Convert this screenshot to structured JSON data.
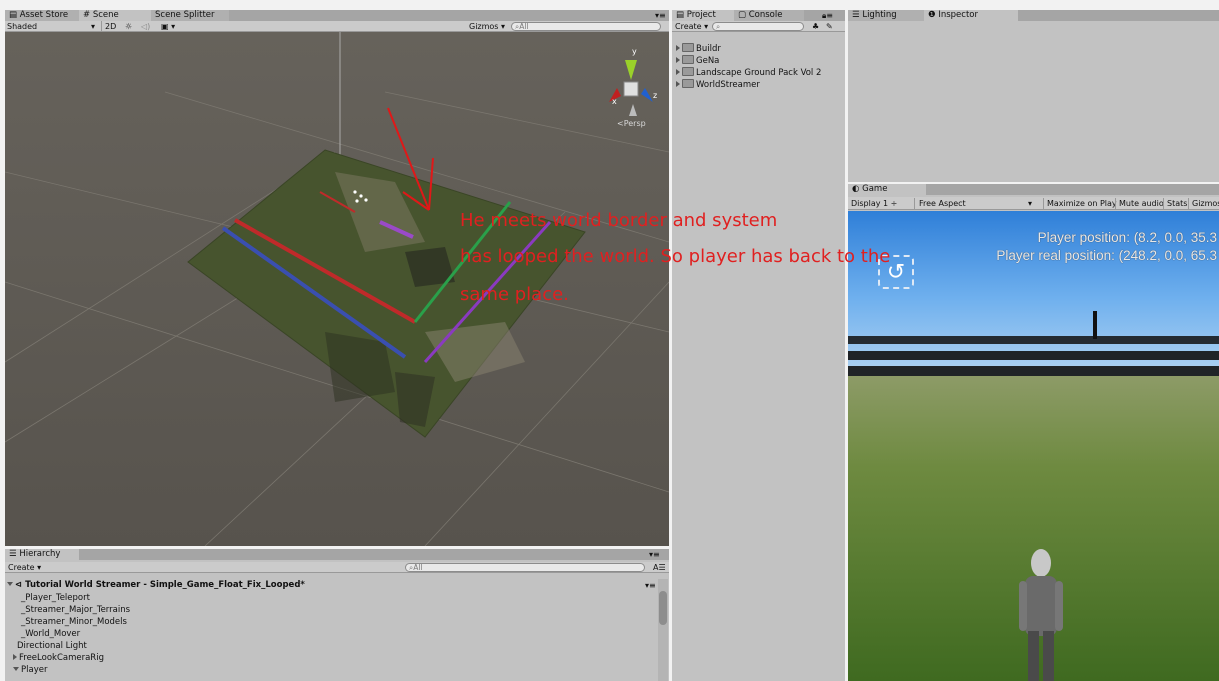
{
  "scene_panel": {
    "tabs": [
      "Asset Store",
      "Scene",
      "Scene Splitter"
    ],
    "draw_mode": "Shaded",
    "mode_2d": "2D",
    "gizmos_label": "Gizmos",
    "search_placeholder": "All",
    "persp_label": "Persp",
    "axis_labels": {
      "x": "x",
      "y": "y",
      "z": "z"
    }
  },
  "project_panel": {
    "tabs": [
      "Project",
      "Console"
    ],
    "create_label": "Create",
    "folders": [
      "Buildr",
      "GeNa",
      "Landscape Ground Pack Vol 2",
      "WorldStreamer"
    ]
  },
  "inspector_panel": {
    "tabs": [
      "Lighting",
      "Inspector"
    ]
  },
  "game_panel": {
    "tab": "Game",
    "display": "Display 1",
    "aspect": "Free Aspect",
    "buttons": [
      "Maximize on Play",
      "Mute audio",
      "Stats",
      "Gizmos"
    ],
    "player_position": "Player position: (8.2, 0.0, 35.3",
    "player_real_position": "Player real position: (248.2, 0.0, 65.3"
  },
  "hierarchy_panel": {
    "tab": "Hierarchy",
    "create_label": "Create",
    "search_placeholder": "All",
    "scene_name": "Tutorial World Streamer - Simple_Game_Float_Fix_Looped*",
    "items": [
      "_Player_Teleport",
      "_Streamer_Major_Terrains",
      "_Streamer_Minor_Models",
      "_World_Mover",
      "Directional Light",
      "FreeLookCameraRig",
      "Player"
    ]
  },
  "annotation": {
    "lines": [
      "He meets world border and system",
      "has looped the world. So player has back to the",
      "same place."
    ],
    "color": "#e02020"
  }
}
